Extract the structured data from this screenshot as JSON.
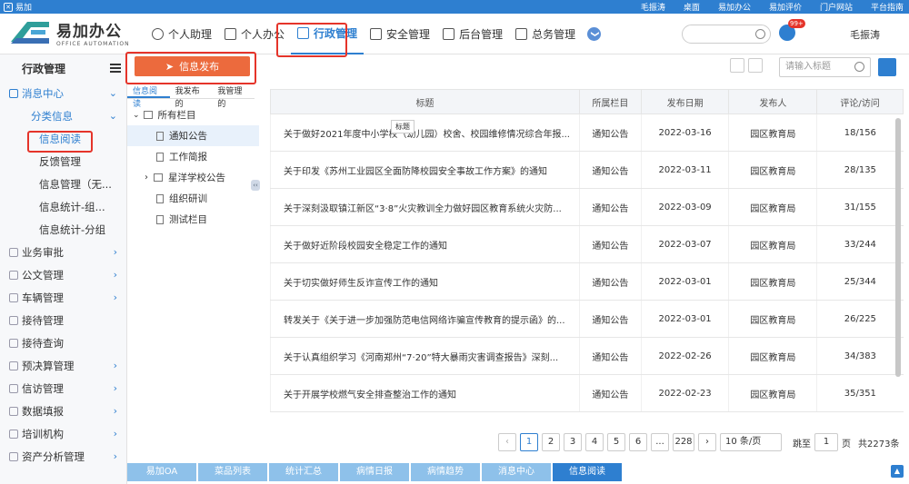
{
  "topbar": {
    "brand": "易加",
    "links": [
      "毛振涛",
      "桌面",
      "易加办公",
      "易加评价",
      "门户网站",
      "平台指南"
    ]
  },
  "logo": {
    "title": "易加办公",
    "subtitle": "OFFICE AUTOMATION"
  },
  "nav": {
    "items": [
      "个人助理",
      "个人办公",
      "行政管理",
      "安全管理",
      "后台管理",
      "总务管理"
    ],
    "more": "❯"
  },
  "header": {
    "badge": "99+",
    "user": "毛振涛"
  },
  "sidebar": {
    "title": "行政管理",
    "items": [
      {
        "label": "消息中心"
      },
      {
        "label": "分类信息"
      },
      {
        "label": "信息阅读"
      },
      {
        "label": "反馈管理"
      },
      {
        "label": "信息管理（无..."
      },
      {
        "label": "信息统计-组..."
      },
      {
        "label": "信息统计-分组"
      },
      {
        "label": "业务审批"
      },
      {
        "label": "公文管理"
      },
      {
        "label": "车辆管理"
      },
      {
        "label": "接待管理"
      },
      {
        "label": "接待查询"
      },
      {
        "label": "预决算管理"
      },
      {
        "label": "信访管理"
      },
      {
        "label": "数据填报"
      },
      {
        "label": "培训机构"
      },
      {
        "label": "资产分析管理"
      }
    ]
  },
  "publish": {
    "label": "信息发布"
  },
  "tabs": [
    "信息阅读",
    "我发布的",
    "我管理的"
  ],
  "tree": {
    "root": "所有栏目",
    "nodes": [
      "通知公告",
      "工作简报",
      "星洋学校公告",
      "组织研训",
      "测试栏目"
    ]
  },
  "search": {
    "placeholder": "请输入标题"
  },
  "table": {
    "headers": [
      "标题",
      "所属栏目",
      "发布日期",
      "发布人",
      "评论/访问"
    ],
    "tooltip": "标题",
    "rows": [
      [
        "关于做好2021年度中小学校（幼儿园）校舍、校园维修情况综合年报...",
        "通知公告",
        "2022-03-16",
        "园区教育局",
        "18/156"
      ],
      [
        "关于印发《苏州工业园区全面防降校园安全事故工作方案》的通知",
        "通知公告",
        "2022-03-11",
        "园区教育局",
        "28/135"
      ],
      [
        "关于深刻汲取镇江新区“3·8”火灾教训全力做好园区教育系统火灾防...",
        "通知公告",
        "2022-03-09",
        "园区教育局",
        "31/155"
      ],
      [
        "关于做好近阶段校园安全稳定工作的通知",
        "通知公告",
        "2022-03-07",
        "园区教育局",
        "33/244"
      ],
      [
        "关于切实做好师生反诈宣传工作的通知",
        "通知公告",
        "2022-03-01",
        "园区教育局",
        "25/344"
      ],
      [
        "转发关于《关于进一步加强防范电信网络诈骗宣传教育的提示函》的...",
        "通知公告",
        "2022-03-01",
        "园区教育局",
        "26/225"
      ],
      [
        "关于认真组织学习《河南郑州“7·20”特大暴雨灾害调查报告》深刻...",
        "通知公告",
        "2022-02-26",
        "园区教育局",
        "34/383"
      ],
      [
        "关于开展学校燃气安全排查整治工作的通知",
        "通知公告",
        "2022-02-23",
        "园区教育局",
        "35/351"
      ]
    ]
  },
  "pager": {
    "pages": [
      "1",
      "2",
      "3",
      "4",
      "5",
      "6",
      "...",
      "228"
    ],
    "per_page": "10  条/页",
    "jump_label": "跳至",
    "jump_value": "1",
    "page_unit": "页",
    "total": "共2273条"
  },
  "bottom_tabs": [
    "易加OA",
    "菜品列表",
    "统计汇总",
    "病情日报",
    "病情趋势",
    "消息中心",
    "信息阅读"
  ]
}
